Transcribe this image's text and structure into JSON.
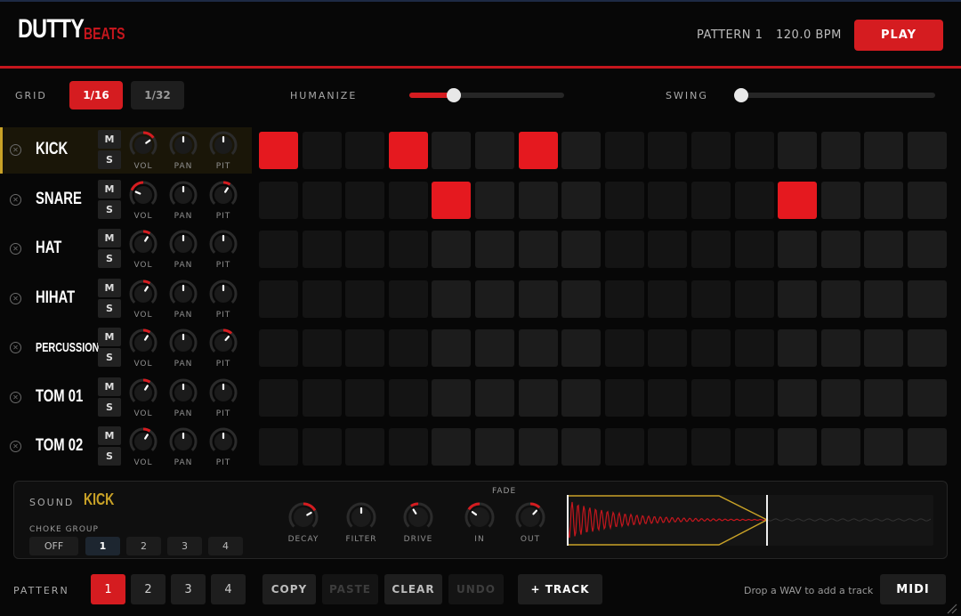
{
  "header": {
    "logo_main": "DUTTY",
    "logo_sub": "BEATS",
    "pattern_name": "PATTERN 1",
    "bpm": "120.0 BPM",
    "play_label": "PLAY"
  },
  "controls": {
    "grid_label": "GRID",
    "grid_options": [
      {
        "label": "1/16",
        "active": true
      },
      {
        "label": "1/32",
        "active": false
      }
    ],
    "humanize_label": "HUMANIZE",
    "humanize_value": 0.29,
    "swing_label": "SWING",
    "swing_value": 0.0
  },
  "knob_labels": [
    "VOL",
    "PAN",
    "PIT"
  ],
  "mute_label": "M",
  "solo_label": "S",
  "tracks": [
    {
      "name": "KICK",
      "selected": true,
      "vol": 0.7,
      "pan": 0.5,
      "pit": 0.5,
      "steps": [
        1,
        0,
        0,
        1,
        0,
        0,
        1,
        0,
        0,
        0,
        0,
        0,
        0,
        0,
        0,
        0
      ]
    },
    {
      "name": "SNARE",
      "selected": false,
      "vol": 0.25,
      "pan": 0.5,
      "pit": 0.62,
      "steps": [
        0,
        0,
        0,
        0,
        1,
        0,
        0,
        0,
        0,
        0,
        0,
        0,
        1,
        0,
        0,
        0
      ]
    },
    {
      "name": "HAT",
      "selected": false,
      "vol": 0.62,
      "pan": 0.5,
      "pit": 0.5,
      "steps": [
        0,
        0,
        0,
        0,
        0,
        0,
        0,
        0,
        0,
        0,
        0,
        0,
        0,
        0,
        0,
        0
      ]
    },
    {
      "name": "HIHAT",
      "selected": false,
      "vol": 0.62,
      "pan": 0.5,
      "pit": 0.5,
      "steps": [
        0,
        0,
        0,
        0,
        0,
        0,
        0,
        0,
        0,
        0,
        0,
        0,
        0,
        0,
        0,
        0
      ]
    },
    {
      "name": "PERCUSSION ...",
      "selected": false,
      "vol": 0.62,
      "pan": 0.5,
      "pit": 0.65,
      "steps": [
        0,
        0,
        0,
        0,
        0,
        0,
        0,
        0,
        0,
        0,
        0,
        0,
        0,
        0,
        0,
        0
      ]
    },
    {
      "name": "TOM 01",
      "selected": false,
      "vol": 0.62,
      "pan": 0.5,
      "pit": 0.5,
      "steps": [
        0,
        0,
        0,
        0,
        0,
        0,
        0,
        0,
        0,
        0,
        0,
        0,
        0,
        0,
        0,
        0
      ]
    },
    {
      "name": "TOM 02",
      "selected": false,
      "vol": 0.62,
      "pan": 0.5,
      "pit": 0.5,
      "steps": [
        0,
        0,
        0,
        0,
        0,
        0,
        0,
        0,
        0,
        0,
        0,
        0,
        0,
        0,
        0,
        0
      ]
    }
  ],
  "sound_panel": {
    "sound_label": "SOUND",
    "sound_name": "KICK",
    "choke_label": "CHOKE GROUP",
    "choke_options": [
      {
        "label": "OFF",
        "active": false
      },
      {
        "label": "1",
        "active": true
      },
      {
        "label": "2",
        "active": false
      },
      {
        "label": "3",
        "active": false
      },
      {
        "label": "4",
        "active": false
      }
    ],
    "fade_label": "FADE",
    "knobs": [
      {
        "label": "DECAY",
        "value": 0.72
      },
      {
        "label": "FILTER",
        "value": 0.5
      },
      {
        "label": "DRIVE",
        "value": 0.38
      },
      {
        "label": "IN",
        "value": 0.3
      },
      {
        "label": "OUT",
        "value": 0.66
      }
    ]
  },
  "footer": {
    "pattern_label": "PATTERN",
    "patterns": [
      {
        "label": "1",
        "active": true
      },
      {
        "label": "2",
        "active": false
      },
      {
        "label": "3",
        "active": false
      },
      {
        "label": "4",
        "active": false
      }
    ],
    "copy_label": "COPY",
    "paste_label": "PASTE",
    "clear_label": "CLEAR",
    "undo_label": "UNDO",
    "add_track_label": "+ TRACK",
    "drop_hint": "Drop a WAV to add a track",
    "midi_label": "MIDI"
  },
  "colors": {
    "accent": "#d51c20",
    "gold": "#c9a227",
    "bg": "#070707"
  }
}
